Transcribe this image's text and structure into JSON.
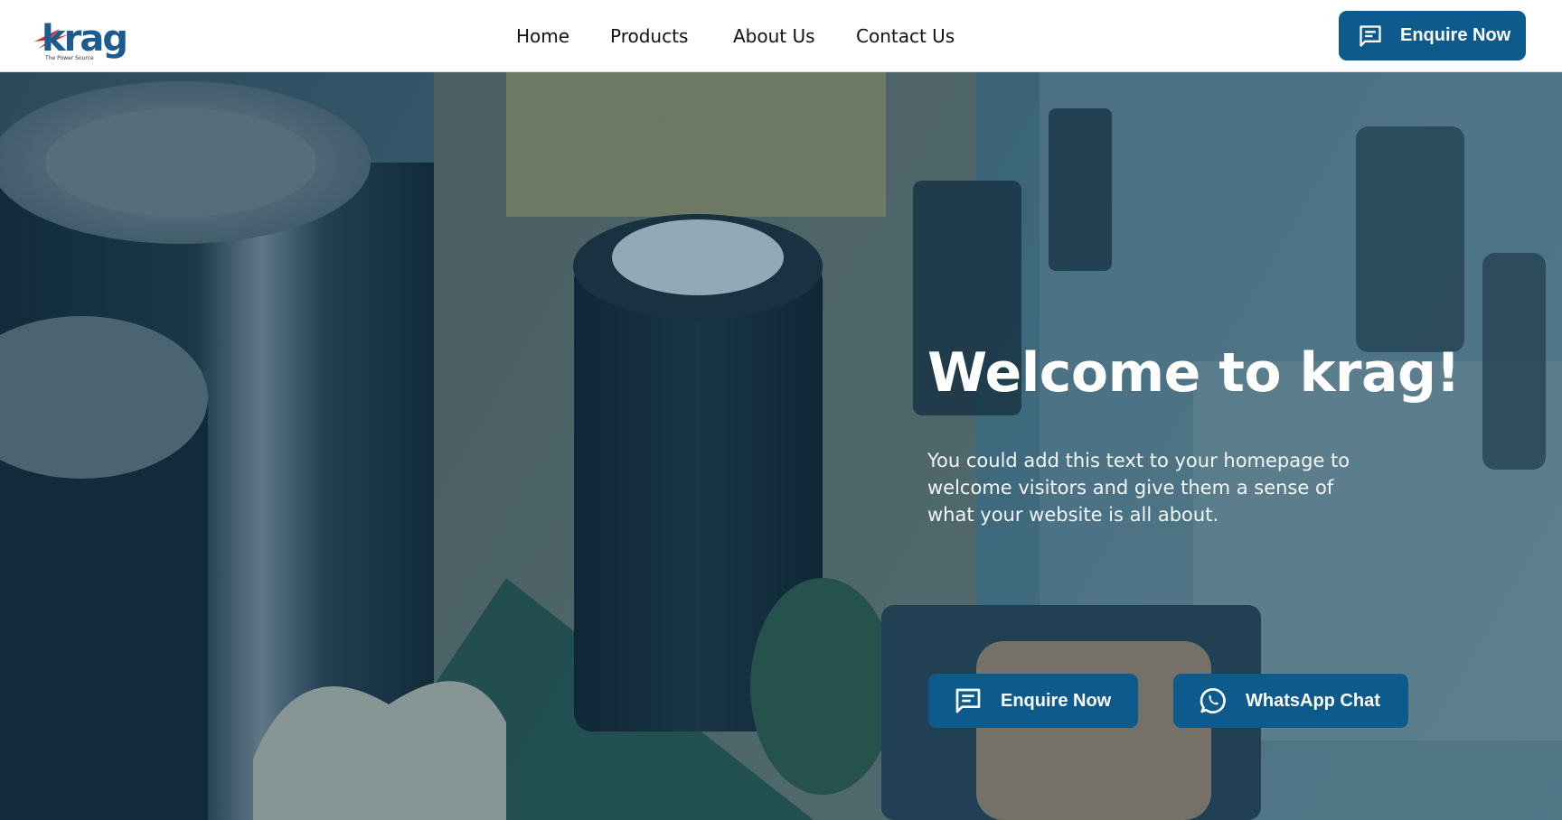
{
  "header": {
    "logo_text": "krag",
    "logo_tagline": "The Power Source",
    "nav": [
      {
        "label": "Home"
      },
      {
        "label": "Products"
      },
      {
        "label": "About Us"
      },
      {
        "label": "Contact Us"
      }
    ],
    "enquire_button": {
      "label": "Enquire Now",
      "icon": "chat-icon"
    }
  },
  "hero": {
    "title": "Welcome to krag!",
    "text": "You could add this text to your homepage to welcome visitors and give them a sense of what your website is all about.",
    "buttons": [
      {
        "label": "Enquire Now",
        "icon": "chat-icon"
      },
      {
        "label": "WhatsApp Chat",
        "icon": "whatsapp-icon"
      }
    ]
  },
  "colors": {
    "accent": "#0d5a8c",
    "logo_blue": "#1b5b8f",
    "logo_red": "#d8262b",
    "header_bg": "#ffffff"
  }
}
